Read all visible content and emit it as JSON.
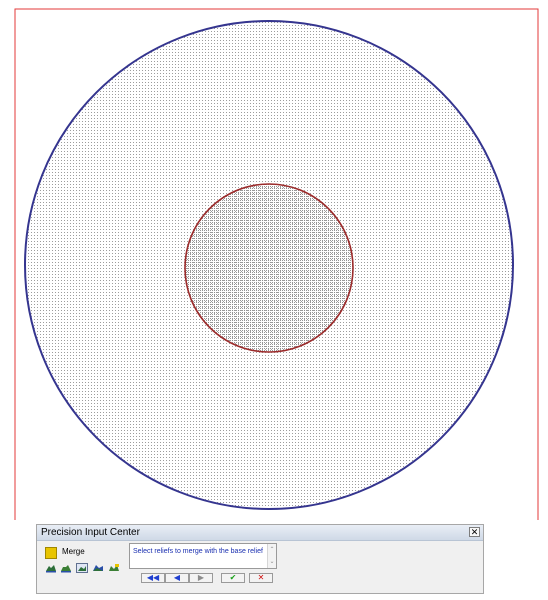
{
  "panel": {
    "title": "Precision Input Center",
    "close_glyph": "✕",
    "merge_label": "Merge",
    "prompt": "Select reliefs to merge with the base relief",
    "scroll_up": "⌃",
    "scroll_down": "⌄",
    "nav_buttons": [
      {
        "name": "first-button",
        "glyph": "◀◀",
        "color": "#1f3fd0"
      },
      {
        "name": "previous-button",
        "glyph": "◀",
        "color": "#1f3fd0"
      },
      {
        "name": "next-button",
        "glyph": "▶",
        "color": "#8c8c8c"
      },
      {
        "name": "accept-button",
        "glyph": "✔",
        "color": "#1aa11a"
      },
      {
        "name": "cancel-button",
        "glyph": "✕",
        "color": "#d01010"
      }
    ],
    "tools": [
      "relief-tool-1-icon",
      "relief-tool-2-icon",
      "relief-tool-3-icon",
      "relief-tool-4-icon",
      "relief-tool-5-icon"
    ]
  },
  "viewport": {
    "bounding_box_color": "#e33a3a",
    "outer_circle_color": "#35358f",
    "inner_circle_color": "#9b2a2a",
    "mesh_color": "#9c9c9c",
    "merge_color": "#e8c400"
  }
}
